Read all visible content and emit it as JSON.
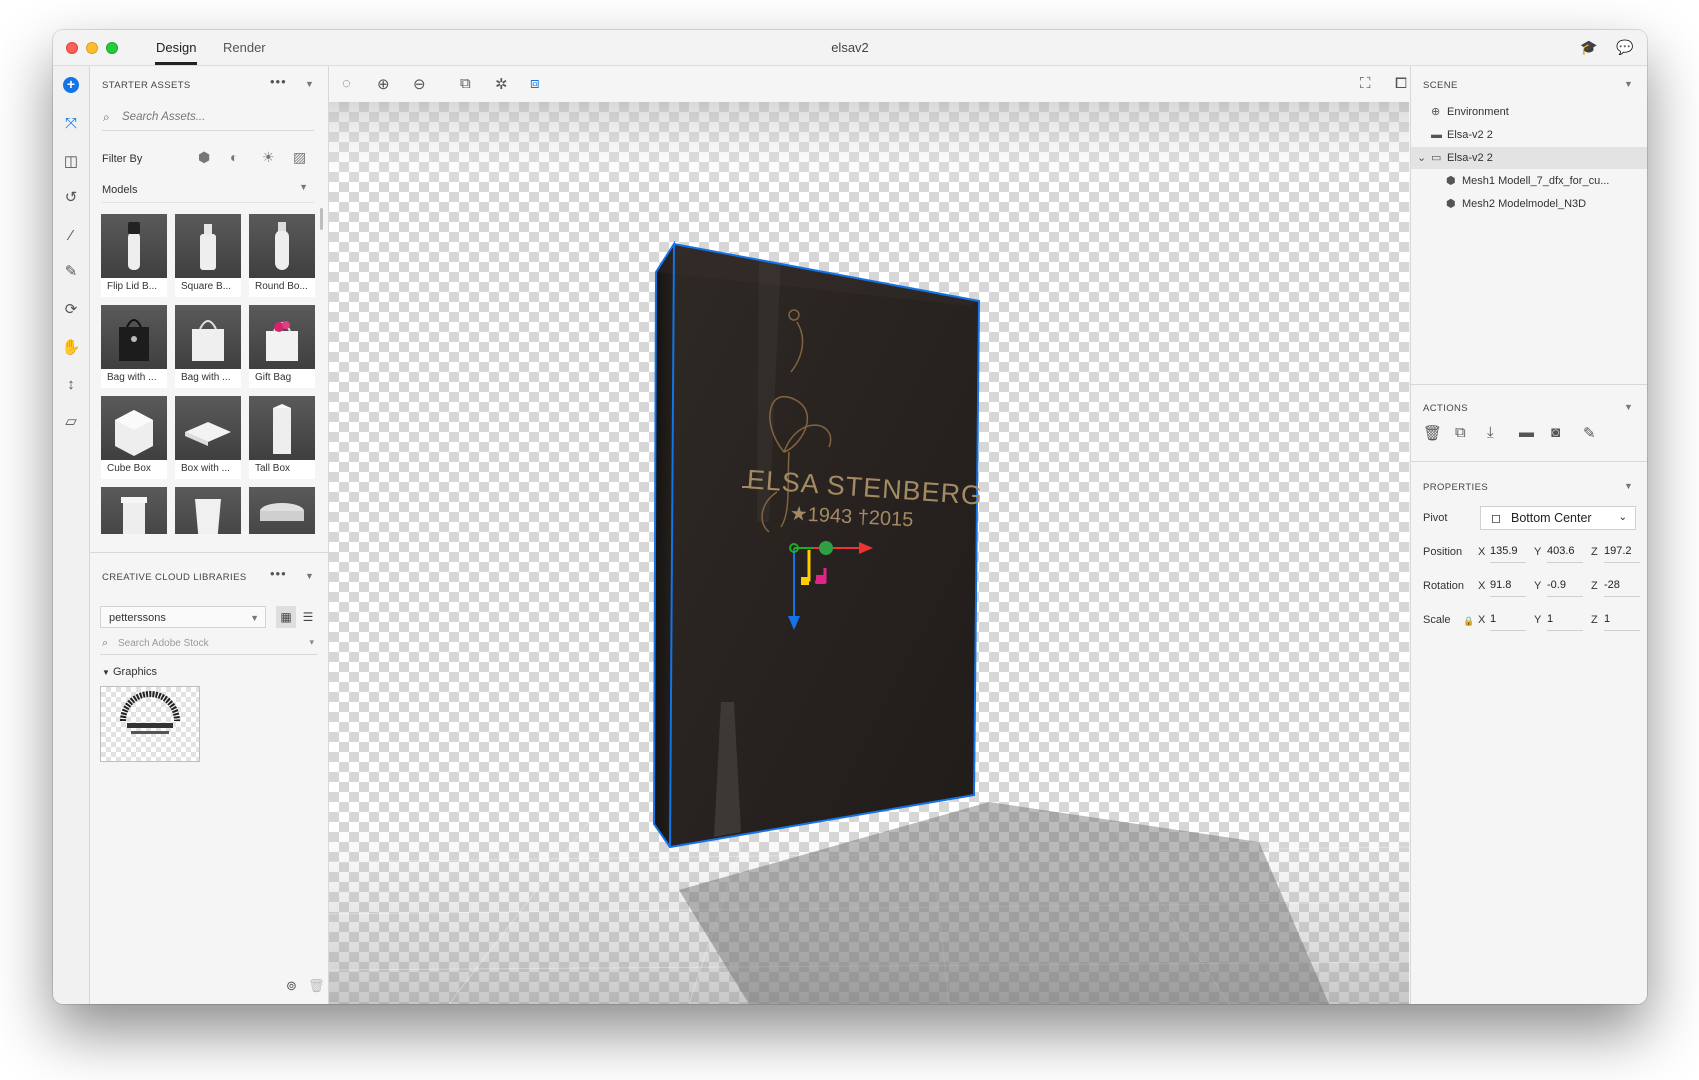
{
  "window": {
    "tabs": [
      {
        "label": "Design",
        "active": true
      },
      {
        "label": "Render",
        "active": false
      }
    ],
    "title": "elsav2",
    "right_icons": [
      "learn-icon",
      "feedback-icon"
    ]
  },
  "rail": {
    "tools": [
      "add-icon",
      "select-move-icon",
      "frame-icon",
      "rotate-view-icon",
      "magic-wand-icon",
      "eyedropper-icon",
      "orbit-icon",
      "pan-icon",
      "dolly-icon",
      "ground-plane-icon"
    ]
  },
  "starter_assets": {
    "title": "STARTER ASSETS",
    "search_placeholder": "Search Assets...",
    "filter_label": "Filter By",
    "filter_icons": [
      "models-filter-icon",
      "materials-filter-icon",
      "lights-filter-icon",
      "images-filter-icon"
    ],
    "category": "Models",
    "items": [
      {
        "label": "Flip Lid B..."
      },
      {
        "label": "Square B..."
      },
      {
        "label": "Round Bo..."
      },
      {
        "label": "Bag with ..."
      },
      {
        "label": "Bag with ..."
      },
      {
        "label": "Gift Bag"
      },
      {
        "label": "Cube Box"
      },
      {
        "label": "Box with ..."
      },
      {
        "label": "Tall Box"
      },
      {
        "label": ""
      },
      {
        "label": ""
      },
      {
        "label": ""
      }
    ]
  },
  "cc_libraries": {
    "title": "CREATIVE CLOUD LIBRARIES",
    "library": "petterssons",
    "stock_placeholder": "Search Adobe Stock",
    "graphics_label": "Graphics",
    "graphic_logo_text": "PETTERSSONS STENHUGGERI"
  },
  "scene": {
    "title": "SCENE",
    "items": [
      {
        "label": "Environment",
        "icon": "globe-icon",
        "indent": 0,
        "selected": false
      },
      {
        "label": "Elsa-v2 2",
        "icon": "folder-icon",
        "indent": 0,
        "selected": false
      },
      {
        "label": "Elsa-v2 2",
        "icon": "folder-icon",
        "indent": 0,
        "selected": true,
        "expanded": true
      },
      {
        "label": "Mesh1 Modell_7_dfx_for_cu...",
        "icon": "mesh-icon",
        "indent": 1,
        "selected": false
      },
      {
        "label": "Mesh2 Modelmodel_N3D",
        "icon": "mesh-icon",
        "indent": 1,
        "selected": false
      }
    ]
  },
  "actions": {
    "title": "ACTIONS",
    "icons": [
      "delete-icon",
      "duplicate-icon",
      "drop-to-ground-icon",
      "group-icon",
      "ungroup-icon",
      "sample-material-icon"
    ]
  },
  "properties": {
    "title": "PROPERTIES",
    "pivot_label": "Pivot",
    "pivot_value": "Bottom Center",
    "position_label": "Position",
    "rotation_label": "Rotation",
    "scale_label": "Scale",
    "position": {
      "x": "135.9",
      "y": "403.6",
      "z": "197.2"
    },
    "rotation": {
      "x": "91.8",
      "y": "-0.9",
      "z": "-28"
    },
    "scale": {
      "x": "1",
      "y": "1",
      "z": "1"
    }
  },
  "viewport": {
    "engraving_name": "ELSA STENBERG",
    "engraving_dates": "★1943  †2015",
    "accent": "#1473e6"
  }
}
